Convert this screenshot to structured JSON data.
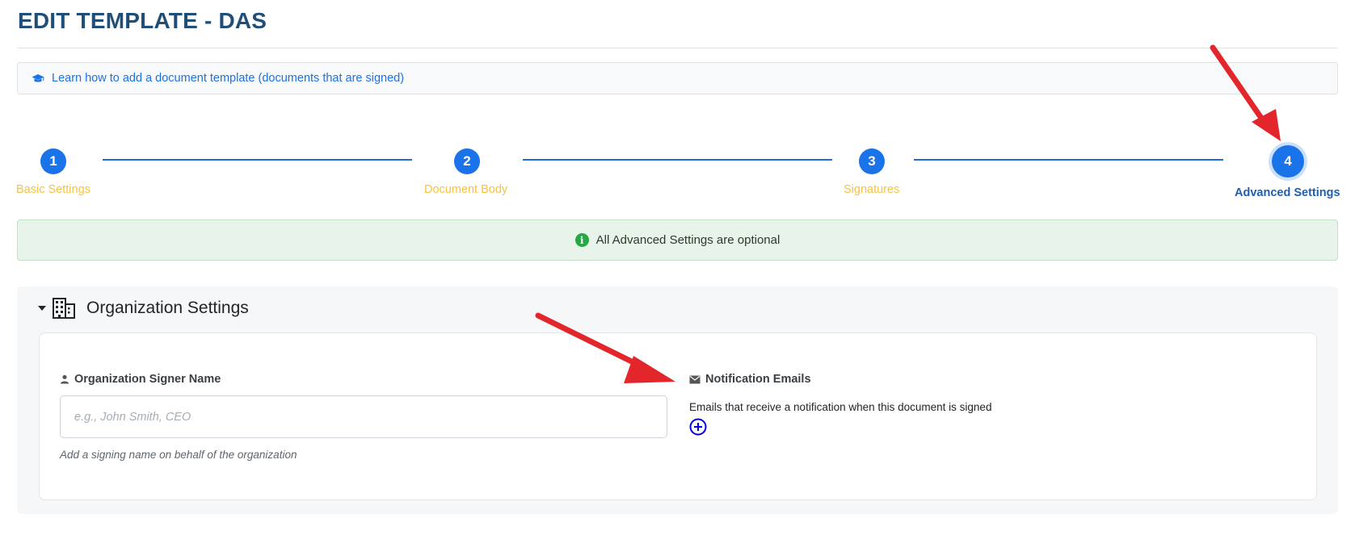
{
  "page": {
    "title": "EDIT TEMPLATE - DAS"
  },
  "help": {
    "icon": "graduation-cap-icon",
    "link_text": "Learn how to add a document template (documents that are signed)"
  },
  "stepper": {
    "steps": [
      {
        "number": "1",
        "label": "Basic Settings",
        "state": "completed"
      },
      {
        "number": "2",
        "label": "Document Body",
        "state": "completed"
      },
      {
        "number": "3",
        "label": "Signatures",
        "state": "completed"
      },
      {
        "number": "4",
        "label": "Advanced Settings",
        "state": "active"
      }
    ]
  },
  "alert": {
    "icon": "info-icon",
    "text": "All Advanced Settings are optional"
  },
  "section": {
    "title": "Organization Settings",
    "icon": "building-icon",
    "expanded": true,
    "signer": {
      "label": "Organization Signer Name",
      "icon": "person-icon",
      "placeholder": "e.g., John Smith, CEO",
      "value": "",
      "help": "Add a signing name on behalf of the organization"
    },
    "notifications": {
      "label": "Notification Emails",
      "icon": "envelope-icon",
      "description": "Emails that receive a notification when this document is signed",
      "add_icon": "plus-circle-icon"
    }
  },
  "colors": {
    "primary": "#1a73e8",
    "completed_label": "#f5c342",
    "active_label": "#1f5fae",
    "success_bg": "#e8f4ea",
    "annotation_arrow": "#e3262b"
  }
}
